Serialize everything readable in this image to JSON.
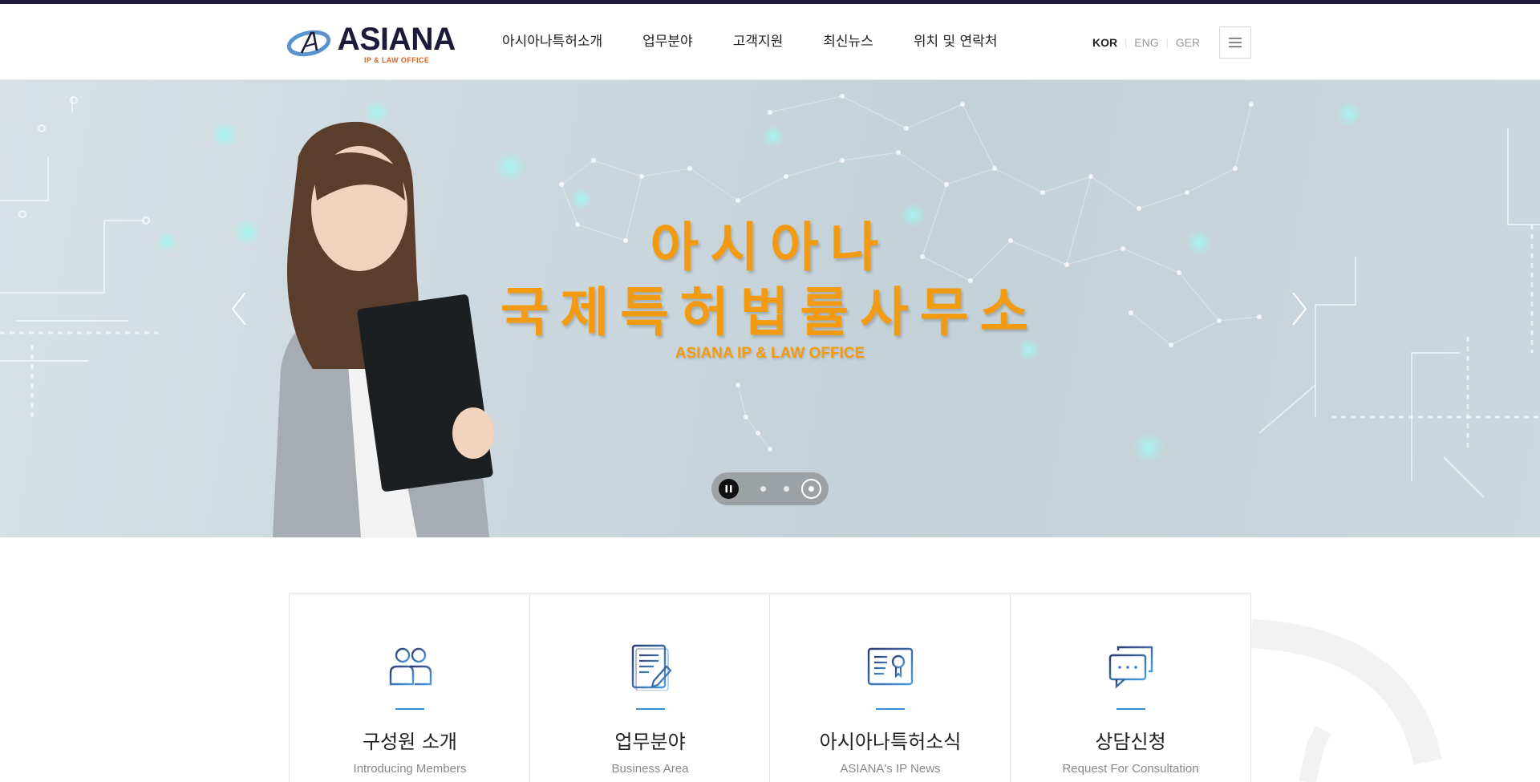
{
  "brand": {
    "name": "ASIANA",
    "tagline": "IP & LAW OFFICE",
    "logo_icon": "asiana-logo-mark",
    "accent": "#f29b12",
    "navy": "#1d1b3a",
    "sub_accent": "#d9641f"
  },
  "nav": {
    "items": [
      "아시아나특허소개",
      "업무분야",
      "고객지원",
      "최신뉴스",
      "위치 및 연락처"
    ]
  },
  "languages": {
    "items": [
      "KOR",
      "ENG",
      "GER"
    ],
    "active": "KOR"
  },
  "menu": {
    "icon": "hamburger-icon"
  },
  "hero": {
    "title_line1": "아시아나",
    "title_line2": "국제특허법률사무소",
    "subtitle": "ASIANA IP & LAW OFFICE",
    "prev_icon": "chevron-left-icon",
    "next_icon": "chevron-right-icon",
    "slides_total": 3,
    "slide_active": 3
  },
  "cards": [
    {
      "title": "구성원 소개",
      "subtitle": "Introducing Members",
      "icon": "people-icon"
    },
    {
      "title": "업무분야",
      "subtitle": "Business Area",
      "icon": "document-edit-icon"
    },
    {
      "title": "아시아나특허소식",
      "subtitle": "ASIANA's IP News",
      "icon": "certificate-icon"
    },
    {
      "title": "상담신청",
      "subtitle": "Request For Consultation",
      "icon": "chat-bubbles-icon"
    }
  ]
}
